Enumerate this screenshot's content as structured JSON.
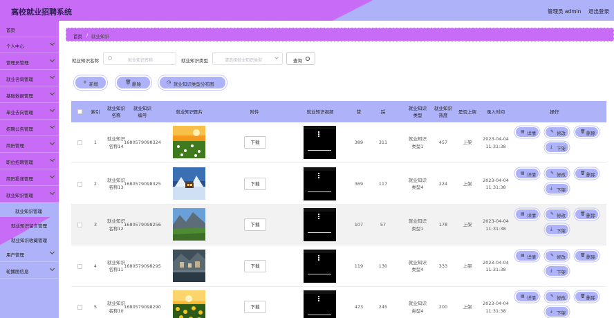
{
  "header": {
    "title": "高校就业招聘系统",
    "user": "管理员 admin",
    "logout": "退出登录"
  },
  "sidebar": {
    "items": [
      {
        "label": "首页"
      },
      {
        "label": "个人中心"
      },
      {
        "label": "管理员管理"
      },
      {
        "label": "就业咨询管理"
      },
      {
        "label": "基础数据管理"
      },
      {
        "label": "毕业去向管理"
      },
      {
        "label": "招聘公告管理"
      },
      {
        "label": "简历管理"
      },
      {
        "label": "职位招聘管理"
      },
      {
        "label": "简历投递管理"
      },
      {
        "label": "就业知识管理"
      }
    ],
    "sub_items": [
      {
        "label": "就业知识管理"
      },
      {
        "label": "就业知识留言管理"
      },
      {
        "label": "就业知识收藏管理"
      }
    ],
    "bottom_items": [
      {
        "label": "用户管理"
      },
      {
        "label": "轮播图信息"
      }
    ]
  },
  "breadcrumb": {
    "home": "首页",
    "separator": "/",
    "current": "就业知识"
  },
  "filters": {
    "name_label": "就业知识名称",
    "name_placeholder": "就业知识名称",
    "type_label": "就业知识类型",
    "type_placeholder": "请选择就业知识类型",
    "query_label": "查询"
  },
  "actions": {
    "add": "新增",
    "delete": "删除",
    "chart": "就业知识类型分布图"
  },
  "table": {
    "headers": {
      "index": "索引",
      "name": "就业知识名称",
      "code": "就业知识编号",
      "image": "就业知识图片",
      "attachment": "附件",
      "video": "就业知识视频",
      "likes": "赞",
      "dislikes": "踩",
      "type": "就业知识类型",
      "heat": "就业知识热度",
      "shelf": "是否上架",
      "time": "录入时间",
      "ops": "操作"
    },
    "download_label": "下载",
    "op_labels": {
      "detail": "详情",
      "edit": "修改",
      "delete": "删除",
      "off": "下架"
    },
    "rows": [
      {
        "index": "1",
        "name": "就业知识名称14",
        "code": "1680579098324",
        "likes": "389",
        "dislikes": "311",
        "type": "就业知识类型1",
        "heat": "457",
        "shelf": "上架",
        "time": "2023-04-04 11:31:38",
        "image": "daisies-sunset"
      },
      {
        "index": "2",
        "name": "就业知识名称13",
        "code": "1680579098325",
        "likes": "369",
        "dislikes": "117",
        "type": "就业知识类型4",
        "heat": "224",
        "shelf": "上架",
        "time": "2023-04-04 11:31:38",
        "image": "snow-cabin"
      },
      {
        "index": "3",
        "name": "就业知识名称12",
        "code": "1680579098256",
        "likes": "107",
        "dislikes": "57",
        "type": "就业知识类型1",
        "heat": "178",
        "shelf": "上架",
        "time": "2023-04-04 11:31:38",
        "image": "mountain-valley"
      },
      {
        "index": "4",
        "name": "就业知识名称11",
        "code": "1680579098295",
        "likes": "119",
        "dislikes": "130",
        "type": "就业知识类型4",
        "heat": "333",
        "shelf": "上架",
        "time": "2023-04-04 11:31:38",
        "image": "lake-village"
      },
      {
        "index": "5",
        "name": "就业知识名称10",
        "code": "1680579098290",
        "likes": "473",
        "dislikes": "245",
        "type": "就业知识类型4",
        "heat": "200",
        "shelf": "上架",
        "time": "2023-04-04 11:31:38",
        "image": "sunflower-field"
      }
    ]
  },
  "colors": {
    "primary": "#c86cf7",
    "secondary": "#aeb2f8"
  }
}
